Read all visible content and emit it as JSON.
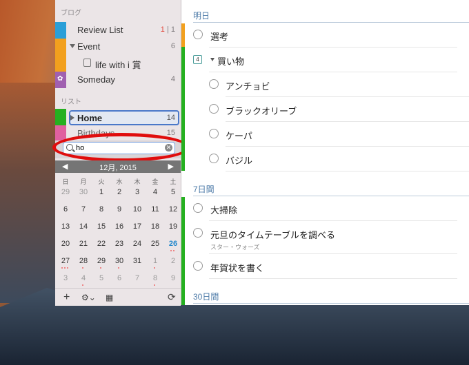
{
  "sidebar": {
    "section_blog": "ブログ",
    "section_list": "リスト",
    "items": [
      {
        "label": "Review List",
        "count_red": "1",
        "count_sep": " | ",
        "count": "1",
        "color": "#2a9fd8"
      },
      {
        "label": "Event",
        "count": "6",
        "color": "#f2a01e"
      },
      {
        "label": "life with i 賞",
        "count": ""
      },
      {
        "label": "Someday",
        "count": "4",
        "color": "#a060b0"
      },
      {
        "label": "Home",
        "count": "14",
        "color": "#25b020"
      },
      {
        "label": "Birthdays",
        "count": "15",
        "color": "#e060a0"
      }
    ]
  },
  "search": {
    "value": "ho"
  },
  "calendar": {
    "month_label": "12月, 2015",
    "dow": [
      "日",
      "月",
      "火",
      "水",
      "木",
      "金",
      "土"
    ],
    "weeks": [
      [
        "29",
        "30",
        "1",
        "2",
        "3",
        "4",
        "5"
      ],
      [
        "6",
        "7",
        "8",
        "9",
        "10",
        "11",
        "12"
      ],
      [
        "13",
        "14",
        "15",
        "16",
        "17",
        "18",
        "19"
      ],
      [
        "20",
        "21",
        "22",
        "23",
        "24",
        "25",
        "26"
      ],
      [
        "27",
        "28",
        "29",
        "30",
        "31",
        "1",
        "2"
      ],
      [
        "3",
        "4",
        "5",
        "6",
        "7",
        "8",
        "9"
      ]
    ]
  },
  "toolbar": {
    "add": "+",
    "gear": "⚙⌄",
    "calendar": "▦",
    "sync": "⟳"
  },
  "main": {
    "section_tomorrow": "明日",
    "section_7days": "7日間",
    "section_30days": "30日間",
    "tasks": [
      {
        "text": "選考"
      },
      {
        "text": "買い物",
        "badge": "4"
      },
      {
        "text": "アンチョビ"
      },
      {
        "text": "ブラックオリーブ"
      },
      {
        "text": "ケーパ"
      },
      {
        "text": "バジル"
      },
      {
        "text": "大掃除"
      },
      {
        "text": "元旦のタイムテーブルを調べる",
        "sub": "スター・ウォーズ"
      },
      {
        "text": "年賀状を書く"
      }
    ]
  },
  "colors": {
    "accent": "#4d7ba8",
    "highlight": "#e00d0d",
    "today": "#2288cc"
  }
}
